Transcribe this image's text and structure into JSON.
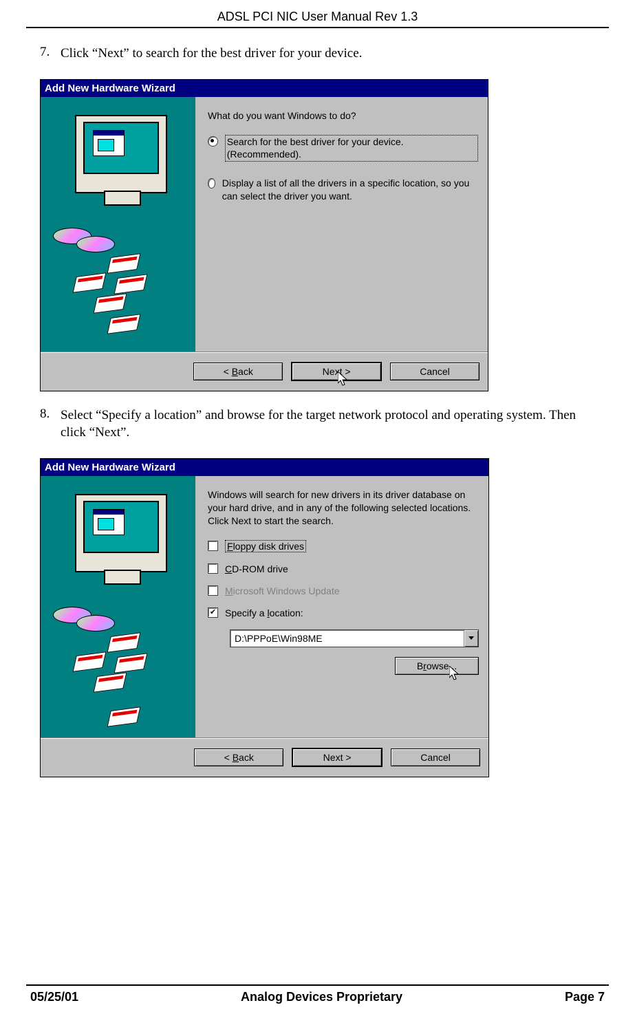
{
  "header": {
    "title": "ADSL PCI NIC User Manual Rev 1.3"
  },
  "steps": [
    {
      "num": "7.",
      "text": "Click “Next” to search for the best driver for your device.",
      "dialog": {
        "title": "Add New Hardware Wizard",
        "prompt": "What do you want Windows to do?",
        "radios": [
          {
            "checked": true,
            "focused": true,
            "label": "Search for the best driver for your device. (Recommended)."
          },
          {
            "checked": false,
            "focused": false,
            "label": "Display a list of all the drivers in a specific location, so you can select the driver you want."
          }
        ],
        "buttons": {
          "back": "< Back",
          "next": "Next >",
          "cancel": "Cancel",
          "default": "next",
          "cursor_on": "next"
        }
      }
    },
    {
      "num": "8.",
      "text": "Select “Specify a location” and browse for the target network protocol and operating system.  Then click “Next”.",
      "dialog": {
        "title": "Add New Hardware Wizard",
        "prompt": "Windows will search for new drivers in its driver database on your hard drive, and in any of the following selected locations. Click Next to start the search.",
        "checks": [
          {
            "checked": false,
            "focused": true,
            "disabled": false,
            "label_html": "<u>F</u>loppy disk drives"
          },
          {
            "checked": false,
            "focused": false,
            "disabled": false,
            "label_html": "<u>C</u>D-ROM drive"
          },
          {
            "checked": false,
            "focused": false,
            "disabled": true,
            "label_html": "<u>M</u>icrosoft Windows Update"
          },
          {
            "checked": true,
            "focused": false,
            "disabled": false,
            "label_html": "Specify a <u>l</u>ocation:"
          }
        ],
        "location_value": "D:\\PPPoE\\Win98ME",
        "browse_label": "Browse...",
        "buttons": {
          "back": "< Back",
          "next": "Next >",
          "cancel": "Cancel",
          "default": "next",
          "cursor_on": "browse"
        }
      }
    }
  ],
  "footer": {
    "left": "05/25/01",
    "center": "Analog Devices Proprietary",
    "right": "Page 7"
  }
}
